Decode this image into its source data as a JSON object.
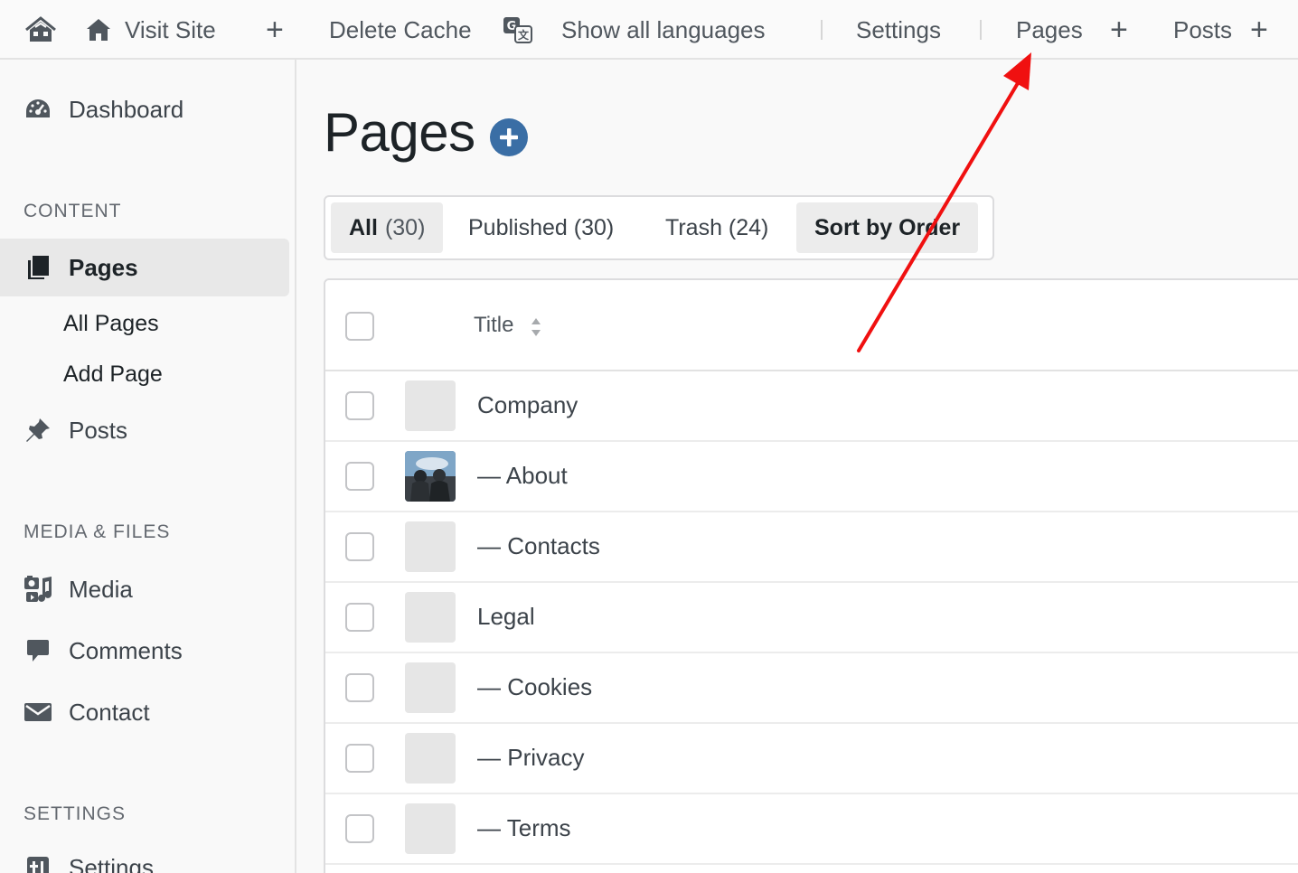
{
  "topbar": {
    "visit_site": "Visit Site",
    "delete_cache": "Delete Cache",
    "show_languages": "Show all languages",
    "settings": "Settings",
    "pages": "Pages",
    "posts": "Posts"
  },
  "sidebar": {
    "dashboard": "Dashboard",
    "content_heading": "CONTENT",
    "pages": "Pages",
    "all_pages": "All Pages",
    "add_page": "Add Page",
    "posts": "Posts",
    "media_heading": "MEDIA & FILES",
    "media": "Media",
    "comments": "Comments",
    "contact": "Contact",
    "settings_heading": "SETTINGS",
    "settings": "Settings"
  },
  "main": {
    "title": "Pages",
    "filters": {
      "all_label": "All",
      "all_count": "(30)",
      "published": "Published (30)",
      "trash": "Trash (24)",
      "sort": "Sort by Order"
    },
    "table": {
      "title_header": "Title",
      "rows": [
        "Company",
        "— About",
        "— Contacts",
        "Legal",
        "— Cookies",
        "— Privacy",
        "— Terms"
      ]
    }
  },
  "colors": {
    "accent": "#3a6ea5",
    "annotation_arrow": "#f01010"
  }
}
